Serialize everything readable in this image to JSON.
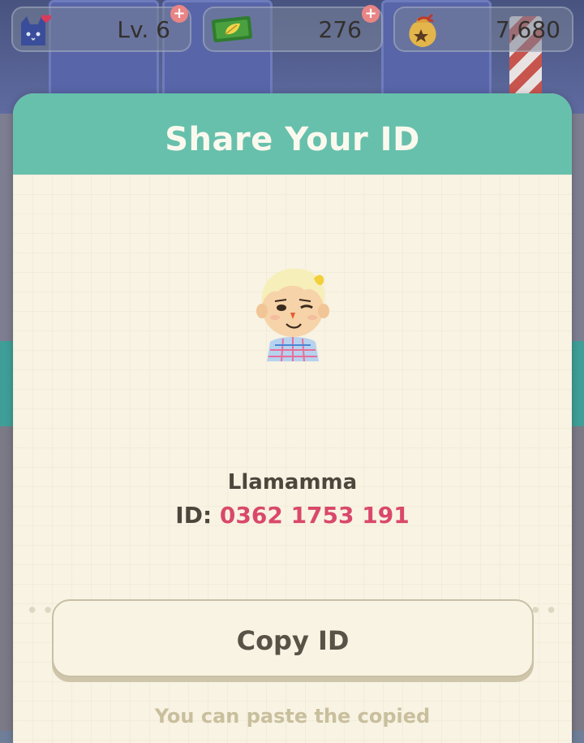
{
  "hud": {
    "level": {
      "value": "Lv. 6",
      "icon": "cat-heart-icon"
    },
    "tickets": {
      "value": "276",
      "icon": "leaf-ticket-icon"
    },
    "bells": {
      "value": "7,680",
      "icon": "bell-bag-icon"
    }
  },
  "dialog": {
    "title": "Share Your ID",
    "player": {
      "name": "Llamamma",
      "id_label": "ID:",
      "id_value": "0362 1753 191"
    },
    "copy_button": "Copy ID",
    "hint": "You can paste the copied"
  },
  "colors": {
    "header": "#67c0ac",
    "panel": "#f8f3e3",
    "id_accent": "#d9486a",
    "hint": "#c9bf9d"
  }
}
